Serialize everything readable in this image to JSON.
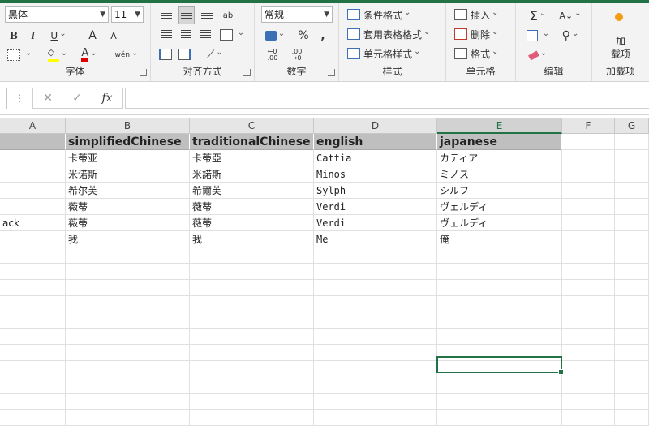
{
  "ribbon": {
    "font": {
      "name": "黑体",
      "size": "11",
      "bold": "B",
      "italic": "I",
      "underline": "U",
      "grow": "A",
      "shrink": "A",
      "font_color_letter": "A",
      "phonetic": "wén",
      "label": "字体"
    },
    "alignment": {
      "label": "对齐方式",
      "wrap": "ab"
    },
    "number": {
      "format": "常规",
      "percent": "%",
      "comma": ",",
      "label": "数字"
    },
    "styles": {
      "conditional": "条件格式",
      "table": "套用表格格式",
      "cell_styles": "单元格样式",
      "label": "样式"
    },
    "cells": {
      "insert": "插入",
      "delete": "删除",
      "format": "格式",
      "label": "单元格"
    },
    "editing": {
      "sum": "Σ",
      "label": "编辑"
    },
    "addins": {
      "button": "加\n载项",
      "label": "加载项"
    }
  },
  "formula_bar": {
    "cancel": "✕",
    "enter": "✓",
    "fx": "fx",
    "value": ""
  },
  "columns": [
    "A",
    "B",
    "C",
    "D",
    "E",
    "F",
    "G"
  ],
  "table": {
    "headers": [
      "",
      "simplifiedChinese",
      "traditionalChinese",
      "english",
      "japanese"
    ],
    "rows": [
      [
        "",
        "卡蒂亚",
        "卡蒂亞",
        "Cattia",
        "カティア"
      ],
      [
        "",
        "米诺斯",
        "米諾斯",
        "Minos",
        "ミノス"
      ],
      [
        "",
        "希尔芙",
        "希爾芙",
        "Sylph",
        "シルフ"
      ],
      [
        "",
        "薇蒂",
        "薇蒂",
        "Verdi",
        "ヴェルディ"
      ],
      [
        "ack",
        "薇蒂",
        "薇蒂",
        "Verdi",
        "ヴェルディ"
      ],
      [
        "",
        "我",
        "我",
        "Me",
        "俺"
      ]
    ]
  },
  "colors": {
    "accent": "#217346",
    "header_fill": "#bfbfbf"
  }
}
